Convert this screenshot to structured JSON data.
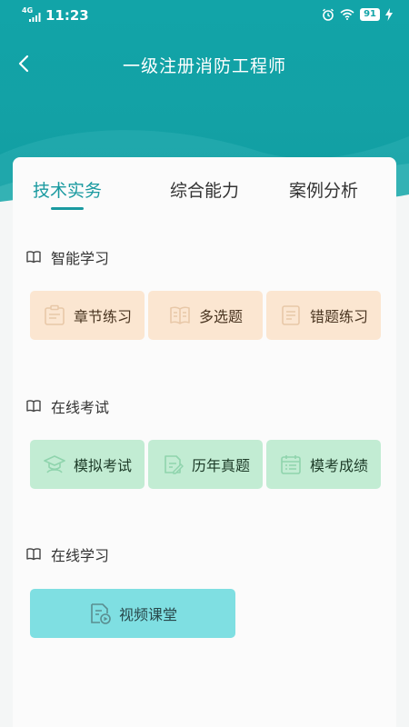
{
  "status": {
    "network": "4G",
    "time": "11:23",
    "battery": "91"
  },
  "header": {
    "title": "一级注册消防工程师"
  },
  "tabs": [
    {
      "label": "技术实务",
      "active": true
    },
    {
      "label": "综合能力",
      "active": false
    },
    {
      "label": "案例分析",
      "active": false
    }
  ],
  "sections": {
    "smart": {
      "title": "智能学习",
      "buttons": [
        {
          "label": "章节练习",
          "icon": "clipboard-icon"
        },
        {
          "label": "多选题",
          "icon": "open-book-icon"
        },
        {
          "label": "错题练习",
          "icon": "document-icon"
        }
      ]
    },
    "exam": {
      "title": "在线考试",
      "buttons": [
        {
          "label": "模拟考试",
          "icon": "graduate-icon"
        },
        {
          "label": "历年真题",
          "icon": "edit-paper-icon"
        },
        {
          "label": "模考成绩",
          "icon": "calendar-list-icon"
        }
      ]
    },
    "online": {
      "title": "在线学习",
      "buttons": [
        {
          "label": "视频课堂",
          "icon": "video-file-icon"
        }
      ]
    }
  },
  "colors": {
    "header": "#12a4a8",
    "accent": "#1a9aa0",
    "orange_btn": "#fbe6d1",
    "green_btn": "#c2ecd3",
    "cyan_btn": "#7fdfe2"
  }
}
